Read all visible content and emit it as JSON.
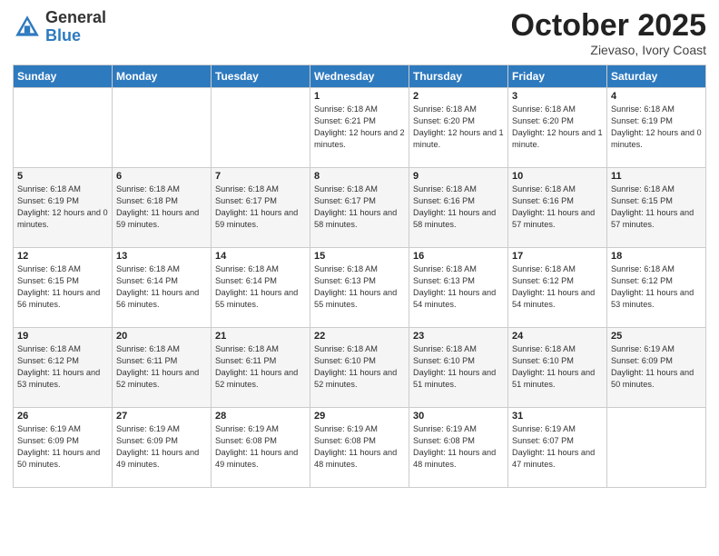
{
  "header": {
    "logo_general": "General",
    "logo_blue": "Blue",
    "month_title": "October 2025",
    "location": "Zievaso, Ivory Coast"
  },
  "weekdays": [
    "Sunday",
    "Monday",
    "Tuesday",
    "Wednesday",
    "Thursday",
    "Friday",
    "Saturday"
  ],
  "weeks": [
    [
      {
        "day": "",
        "info": ""
      },
      {
        "day": "",
        "info": ""
      },
      {
        "day": "",
        "info": ""
      },
      {
        "day": "1",
        "info": "Sunrise: 6:18 AM\nSunset: 6:21 PM\nDaylight: 12 hours\nand 2 minutes."
      },
      {
        "day": "2",
        "info": "Sunrise: 6:18 AM\nSunset: 6:20 PM\nDaylight: 12 hours\nand 1 minute."
      },
      {
        "day": "3",
        "info": "Sunrise: 6:18 AM\nSunset: 6:20 PM\nDaylight: 12 hours\nand 1 minute."
      },
      {
        "day": "4",
        "info": "Sunrise: 6:18 AM\nSunset: 6:19 PM\nDaylight: 12 hours\nand 0 minutes."
      }
    ],
    [
      {
        "day": "5",
        "info": "Sunrise: 6:18 AM\nSunset: 6:19 PM\nDaylight: 12 hours\nand 0 minutes."
      },
      {
        "day": "6",
        "info": "Sunrise: 6:18 AM\nSunset: 6:18 PM\nDaylight: 11 hours\nand 59 minutes."
      },
      {
        "day": "7",
        "info": "Sunrise: 6:18 AM\nSunset: 6:17 PM\nDaylight: 11 hours\nand 59 minutes."
      },
      {
        "day": "8",
        "info": "Sunrise: 6:18 AM\nSunset: 6:17 PM\nDaylight: 11 hours\nand 58 minutes."
      },
      {
        "day": "9",
        "info": "Sunrise: 6:18 AM\nSunset: 6:16 PM\nDaylight: 11 hours\nand 58 minutes."
      },
      {
        "day": "10",
        "info": "Sunrise: 6:18 AM\nSunset: 6:16 PM\nDaylight: 11 hours\nand 57 minutes."
      },
      {
        "day": "11",
        "info": "Sunrise: 6:18 AM\nSunset: 6:15 PM\nDaylight: 11 hours\nand 57 minutes."
      }
    ],
    [
      {
        "day": "12",
        "info": "Sunrise: 6:18 AM\nSunset: 6:15 PM\nDaylight: 11 hours\nand 56 minutes."
      },
      {
        "day": "13",
        "info": "Sunrise: 6:18 AM\nSunset: 6:14 PM\nDaylight: 11 hours\nand 56 minutes."
      },
      {
        "day": "14",
        "info": "Sunrise: 6:18 AM\nSunset: 6:14 PM\nDaylight: 11 hours\nand 55 minutes."
      },
      {
        "day": "15",
        "info": "Sunrise: 6:18 AM\nSunset: 6:13 PM\nDaylight: 11 hours\nand 55 minutes."
      },
      {
        "day": "16",
        "info": "Sunrise: 6:18 AM\nSunset: 6:13 PM\nDaylight: 11 hours\nand 54 minutes."
      },
      {
        "day": "17",
        "info": "Sunrise: 6:18 AM\nSunset: 6:12 PM\nDaylight: 11 hours\nand 54 minutes."
      },
      {
        "day": "18",
        "info": "Sunrise: 6:18 AM\nSunset: 6:12 PM\nDaylight: 11 hours\nand 53 minutes."
      }
    ],
    [
      {
        "day": "19",
        "info": "Sunrise: 6:18 AM\nSunset: 6:12 PM\nDaylight: 11 hours\nand 53 minutes."
      },
      {
        "day": "20",
        "info": "Sunrise: 6:18 AM\nSunset: 6:11 PM\nDaylight: 11 hours\nand 52 minutes."
      },
      {
        "day": "21",
        "info": "Sunrise: 6:18 AM\nSunset: 6:11 PM\nDaylight: 11 hours\nand 52 minutes."
      },
      {
        "day": "22",
        "info": "Sunrise: 6:18 AM\nSunset: 6:10 PM\nDaylight: 11 hours\nand 52 minutes."
      },
      {
        "day": "23",
        "info": "Sunrise: 6:18 AM\nSunset: 6:10 PM\nDaylight: 11 hours\nand 51 minutes."
      },
      {
        "day": "24",
        "info": "Sunrise: 6:18 AM\nSunset: 6:10 PM\nDaylight: 11 hours\nand 51 minutes."
      },
      {
        "day": "25",
        "info": "Sunrise: 6:19 AM\nSunset: 6:09 PM\nDaylight: 11 hours\nand 50 minutes."
      }
    ],
    [
      {
        "day": "26",
        "info": "Sunrise: 6:19 AM\nSunset: 6:09 PM\nDaylight: 11 hours\nand 50 minutes."
      },
      {
        "day": "27",
        "info": "Sunrise: 6:19 AM\nSunset: 6:09 PM\nDaylight: 11 hours\nand 49 minutes."
      },
      {
        "day": "28",
        "info": "Sunrise: 6:19 AM\nSunset: 6:08 PM\nDaylight: 11 hours\nand 49 minutes."
      },
      {
        "day": "29",
        "info": "Sunrise: 6:19 AM\nSunset: 6:08 PM\nDaylight: 11 hours\nand 48 minutes."
      },
      {
        "day": "30",
        "info": "Sunrise: 6:19 AM\nSunset: 6:08 PM\nDaylight: 11 hours\nand 48 minutes."
      },
      {
        "day": "31",
        "info": "Sunrise: 6:19 AM\nSunset: 6:07 PM\nDaylight: 11 hours\nand 47 minutes."
      },
      {
        "day": "",
        "info": ""
      }
    ]
  ]
}
